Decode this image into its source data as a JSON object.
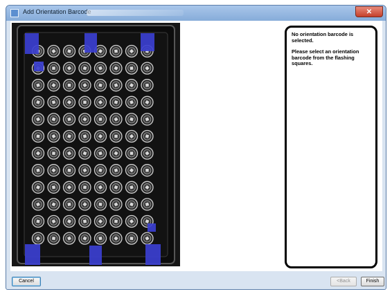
{
  "window": {
    "title": "Add Orientation Barcode",
    "close_glyph": "✕"
  },
  "instructions": {
    "line1": "No orientation barcode is selected.",
    "line2": "Please select an orientation barcode from the flashing squares."
  },
  "rack": {
    "rows": 12,
    "columns": 8,
    "marker_color": "#3b3fd0"
  },
  "footer": {
    "cancel_label": "Cancel",
    "back_label": "<Back",
    "finish_label": "Finish"
  },
  "colors": {
    "titlebar": "#9fc0e8",
    "window_frame": "#d9e4f1",
    "instruction_border": "#000000"
  }
}
